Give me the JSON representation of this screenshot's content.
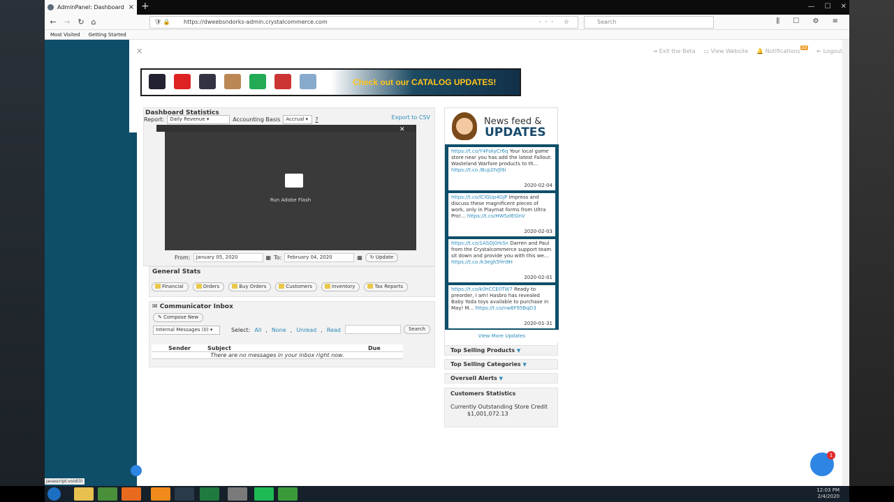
{
  "browser": {
    "tab_title": "AdminPanel: Dashboard",
    "url": "https://dweebsndorks-admin.crystalcommerce.com",
    "search_placeholder": "Search",
    "bookmarks": [
      "Most Visited",
      "Getting Started"
    ]
  },
  "topnav": {
    "exit_beta": "Exit the Beta",
    "view_website": "View Website",
    "notifications": "Notifications",
    "notifications_count": "22",
    "logout": "Logout"
  },
  "banner": {
    "text": "Check out our CATALOG UPDATES!"
  },
  "dashboard_stats": {
    "title": "Dashboard Statistics",
    "report_label": "Report:",
    "report_value": "Daily Revenue",
    "accounting_label": "Accounting Basis",
    "accounting_value": "Accrual",
    "help": "?",
    "export": "Export to CSV",
    "flash_label": "Run Adobe Flash",
    "from_label": "From:",
    "from_value": "January 05, 2020",
    "to_label": "To:",
    "to_value": "February 04, 2020",
    "update_button": "Update"
  },
  "general_stats": {
    "title": "General Stats",
    "buttons": [
      "Financial",
      "Orders",
      "Buy Orders",
      "Customers",
      "Inventory",
      "Tax Reports"
    ]
  },
  "inbox": {
    "title": "Communicator Inbox",
    "compose": "Compose New",
    "folder": "Internal Messages (0)",
    "select_label": "Select:",
    "select_all": "All",
    "select_none": "None",
    "select_unread": "Unread",
    "select_read": "Read",
    "search_button": "Search",
    "col_sender": "Sender",
    "col_subject": "Subject",
    "col_due": "Due",
    "empty": "There are no messages in your inbox right now."
  },
  "news": {
    "title_top": "News feed &",
    "title_bottom": "UPDATES",
    "items": [
      {
        "link": "https://t.co/Y4FskyCr6q",
        "text": " Your local game store near you has add the latest Fallout: Wasteland Warfare products to th...",
        "link2": "https://t.co /Bcp2tVJl9i",
        "date": "2020-02-04"
      },
      {
        "link": "https://t.co/lClGUp4GjP",
        "text": " Impress and discuss these magnificent pieces of work, only in Playmat forms from Ultra Pro!...",
        "link2": "https://t.co/HW5zl6SlnV",
        "date": "2020-02-03"
      },
      {
        "link": "https://t.co/1ASOj0rkSn",
        "text": " Darren and Paul from the Crystalcommerce support team sit down and provide you with this we...",
        "link2": "https://t.co /k3egh5fm9H",
        "date": "2020-02-01"
      },
      {
        "link": "https://t.co/k0hCCE0TW7",
        "text": " Ready to preorder, I am! Hasbro has revealed Baby Yoda toys available to purchase in May! M...",
        "link2": "https://t.co/nw6F95BqD3",
        "date": "2020-01-31"
      }
    ],
    "more": "View More Updates"
  },
  "side": {
    "top_products": "Top Selling Products",
    "top_categories": "Top Selling Categories",
    "oversell": "Oversell Alerts",
    "cust_title": "Customers Statistics",
    "cust_label": "Currently Outstanding Store Credit",
    "cust_value": "$1,001,072.13"
  },
  "chat": {
    "badge": "1"
  },
  "statusbar": {
    "link": "javascript:void(0)"
  },
  "clock": {
    "time": "12:03 PM",
    "date": "2/4/2020"
  },
  "colors": {
    "sidebar": "#0e4e69",
    "accent": "#2a8ab8",
    "banner_text": "#ffc51a"
  }
}
